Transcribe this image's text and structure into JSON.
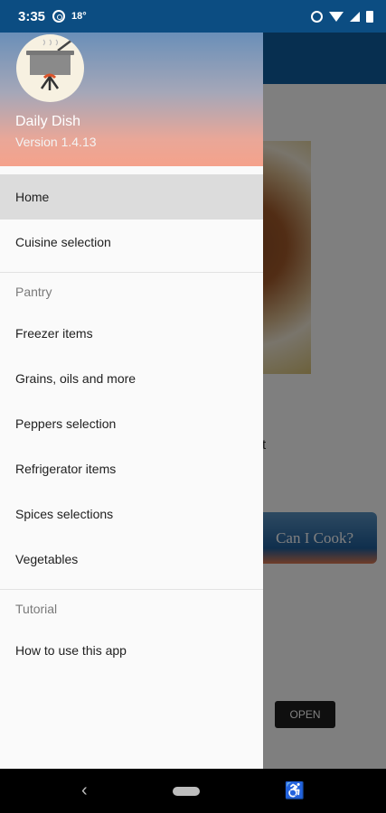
{
  "status_bar": {
    "time": "3:35",
    "temperature": "18°",
    "icons": [
      "whatsapp-icon",
      "alarm-icon",
      "wifi-icon",
      "signal-icon",
      "battery-icon"
    ]
  },
  "background_app": {
    "partial_text": "t",
    "cook_button_label": "Can I Cook?",
    "open_button_label": "OPEN"
  },
  "drawer": {
    "app_name": "Daily Dish",
    "version": "Version 1.4.13",
    "logo_icon": "cooking-pot-icon",
    "main_items": [
      {
        "label": "Home",
        "active": true
      },
      {
        "label": "Cuisine selection",
        "active": false
      }
    ],
    "pantry_section": {
      "title": "Pantry",
      "items": [
        {
          "label": "Freezer items"
        },
        {
          "label": "Grains, oils and more"
        },
        {
          "label": "Peppers selection"
        },
        {
          "label": "Refrigerator items"
        },
        {
          "label": "Spices selections"
        },
        {
          "label": "Vegetables"
        }
      ]
    },
    "tutorial_section": {
      "title": "Tutorial",
      "items": [
        {
          "label": "How to use this app"
        }
      ]
    }
  },
  "nav_bar": {
    "back_glyph": "‹",
    "accessibility_glyph": "♿"
  },
  "colors": {
    "status_bar": "#0c4d82",
    "app_bar": "#0f5fa1",
    "drawer_bg": "#fafafa",
    "active_item_bg": "#dcdcdc"
  }
}
